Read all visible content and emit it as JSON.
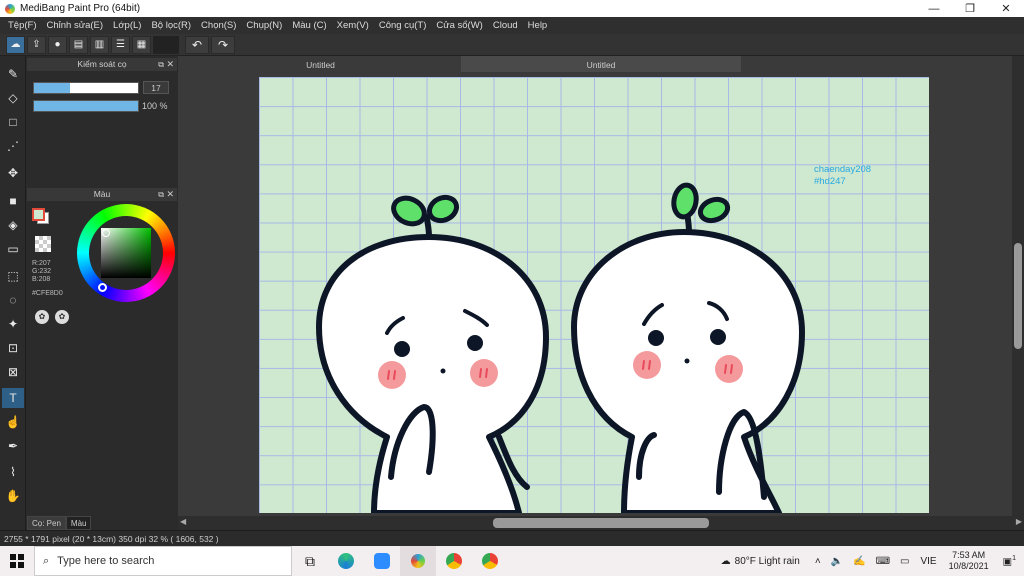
{
  "window": {
    "title": "MediBang Paint Pro (64bit)",
    "min": "—",
    "max": "❐",
    "close": "✕"
  },
  "menu": [
    "Tệp(F)",
    "Chỉnh sửa(E)",
    "Lớp(L)",
    "Bộ lọc(R)",
    "Chọn(S)",
    "Chụp(N)",
    "Màu (C)",
    "Xem(V)",
    "Công cụ(T)",
    "Cửa sổ(W)",
    "Cloud",
    "Help"
  ],
  "brush_panel": {
    "title": "Kiểm soát cọ",
    "size_value": "17",
    "size_fraction": 0.35,
    "opacity_label": "100 %",
    "opacity_fraction": 1.0
  },
  "color_panel": {
    "title": "Màu",
    "r": "R:207",
    "g": "G:232",
    "b": "B:208",
    "hex": "#CFE8D0",
    "fg_color": "#cfe8d0",
    "bg_color": "#ffffff"
  },
  "bottom_tabs": [
    "Cọ: Pen",
    "Màu"
  ],
  "doc_tabs": [
    "Untitled",
    "Untitled"
  ],
  "canvas": {
    "annotation_line1": "chaenday208",
    "annotation_line2": "#hd247",
    "paper_color": "#cfe8d0",
    "grid_color": "#a7b9e6"
  },
  "status": {
    "size": "2755 * 1791 pixel",
    "cm": "(20 * 13cm)",
    "dpi": "350 dpi",
    "zoom": "32 %",
    "coords": "( 1606, 532 )"
  },
  "taskbar": {
    "search_placeholder": "Type here to search",
    "weather": "80°F  Light rain",
    "lang": "VIE",
    "time": "7:53 AM",
    "date": "10/8/2021",
    "notif_count": "1"
  }
}
